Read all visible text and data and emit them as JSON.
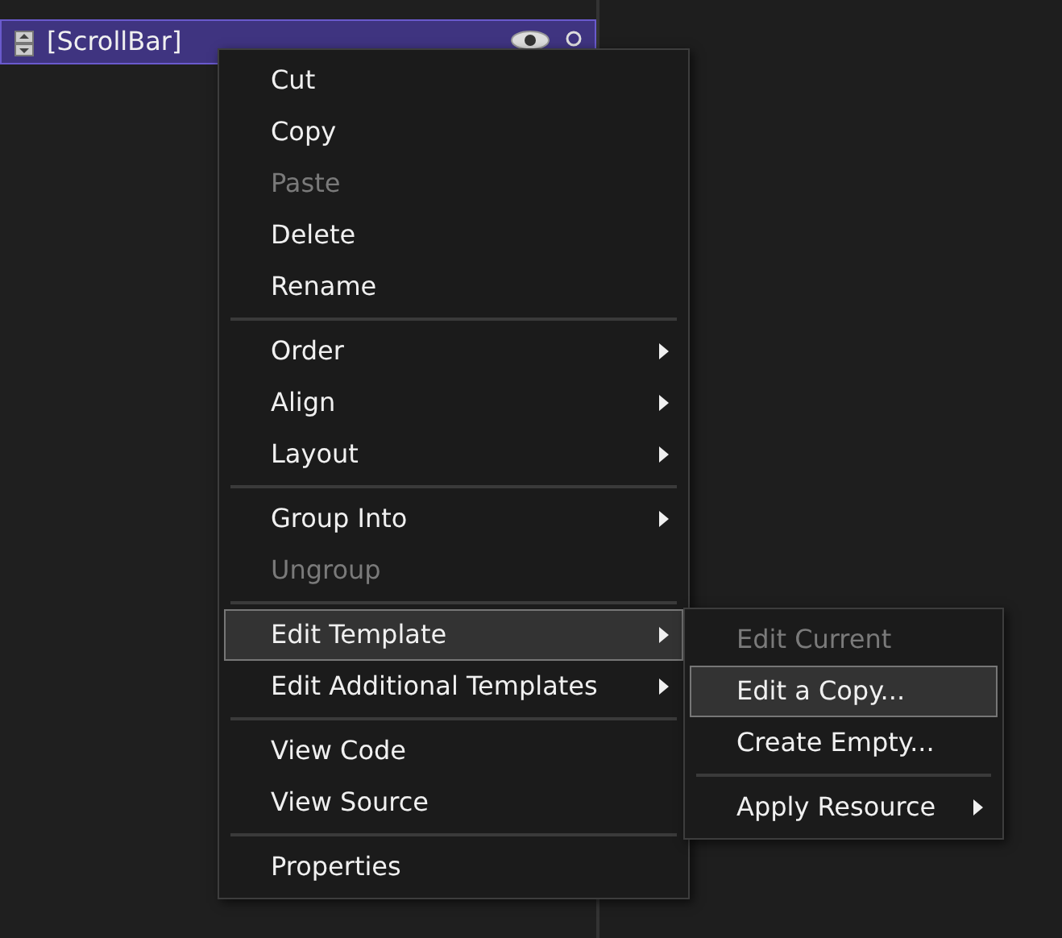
{
  "tree": [
    {
      "label": "[ScrollBar]",
      "selected": true
    }
  ],
  "context_menu": {
    "items": [
      {
        "kind": "item",
        "label": "Cut",
        "disabled": false,
        "submenu": false,
        "selected": false
      },
      {
        "kind": "item",
        "label": "Copy",
        "disabled": false,
        "submenu": false,
        "selected": false
      },
      {
        "kind": "item",
        "label": "Paste",
        "disabled": true,
        "submenu": false,
        "selected": false
      },
      {
        "kind": "item",
        "label": "Delete",
        "disabled": false,
        "submenu": false,
        "selected": false
      },
      {
        "kind": "item",
        "label": "Rename",
        "disabled": false,
        "submenu": false,
        "selected": false
      },
      {
        "kind": "separator"
      },
      {
        "kind": "item",
        "label": "Order",
        "disabled": false,
        "submenu": true,
        "selected": false
      },
      {
        "kind": "item",
        "label": "Align",
        "disabled": false,
        "submenu": true,
        "selected": false
      },
      {
        "kind": "item",
        "label": "Layout",
        "disabled": false,
        "submenu": true,
        "selected": false
      },
      {
        "kind": "separator"
      },
      {
        "kind": "item",
        "label": "Group Into",
        "disabled": false,
        "submenu": true,
        "selected": false
      },
      {
        "kind": "item",
        "label": "Ungroup",
        "disabled": true,
        "submenu": false,
        "selected": false
      },
      {
        "kind": "separator"
      },
      {
        "kind": "item",
        "label": "Edit Template",
        "disabled": false,
        "submenu": true,
        "selected": true
      },
      {
        "kind": "item",
        "label": "Edit Additional Templates",
        "disabled": false,
        "submenu": true,
        "selected": false
      },
      {
        "kind": "separator"
      },
      {
        "kind": "item",
        "label": "View Code",
        "disabled": false,
        "submenu": false,
        "selected": false
      },
      {
        "kind": "item",
        "label": "View Source",
        "disabled": false,
        "submenu": false,
        "selected": false
      },
      {
        "kind": "separator"
      },
      {
        "kind": "item",
        "label": "Properties",
        "disabled": false,
        "submenu": false,
        "selected": false
      }
    ]
  },
  "submenu": {
    "items": [
      {
        "kind": "item",
        "label": "Edit Current",
        "disabled": true,
        "submenu": false,
        "selected": false
      },
      {
        "kind": "item",
        "label": "Edit a Copy...",
        "disabled": false,
        "submenu": false,
        "selected": true
      },
      {
        "kind": "item",
        "label": "Create Empty...",
        "disabled": false,
        "submenu": false,
        "selected": false
      },
      {
        "kind": "separator"
      },
      {
        "kind": "item",
        "label": "Apply Resource",
        "disabled": false,
        "submenu": true,
        "selected": false
      }
    ]
  }
}
